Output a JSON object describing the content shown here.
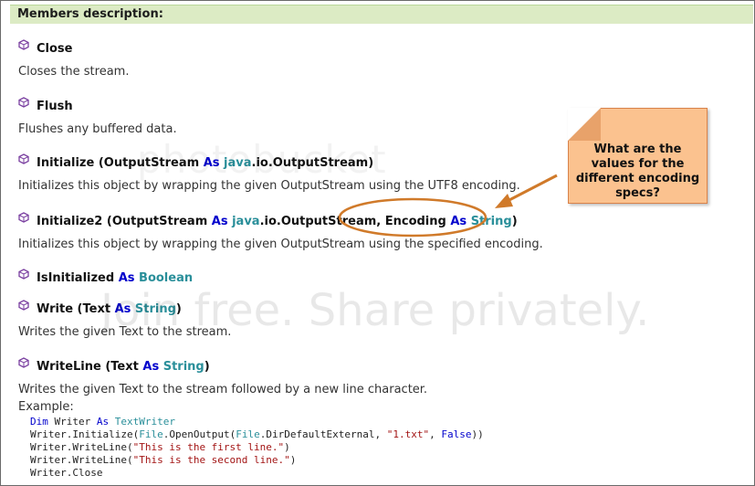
{
  "header": {
    "title": "Members description:"
  },
  "members": [
    {
      "name": "Close",
      "description": "Closes the stream."
    },
    {
      "name": "Flush",
      "description": "Flushes any buffered data."
    },
    {
      "name": "Initialize",
      "p1": "(OutputStream ",
      "as": "As ",
      "pkg": "java",
      "rest": ".io.OutputStream)",
      "description": "Initializes this object by wrapping the given OutputStream using the UTF8 encoding."
    },
    {
      "name": "Initialize2",
      "p1": "(OutputStream ",
      "as": "As ",
      "pkg": "java",
      "rest": ".io.OutputStream, Encoding ",
      "as2": "As ",
      "type2": "String",
      "close": ")",
      "description": "Initializes this object by wrapping the given OutputStream using the specified encoding."
    },
    {
      "name": "IsInitialized",
      "as": " As ",
      "type": "Boolean"
    },
    {
      "name": "Write",
      "p1": " (Text ",
      "as": "As ",
      "type": "String",
      "close": ")",
      "description": "Writes the given Text to the stream."
    },
    {
      "name": "WriteLine",
      "p1": " (Text ",
      "as": "As ",
      "type": "String",
      "close": ")",
      "description": "Writes the given Text to the stream followed by a new line character."
    }
  ],
  "example_label": "Example:",
  "code": {
    "l1_kw1": "Dim",
    "l1_mid": " Writer ",
    "l1_kw2": "As",
    "l1_type": " TextWriter",
    "l2_a": "Writer.Initialize(",
    "l2_type1": "File",
    "l2_b": ".OpenOutput(",
    "l2_type2": "File",
    "l2_c": ".DirDefaultExternal, ",
    "l2_str": "\"1.txt\"",
    "l2_d": ", ",
    "l2_kw": "False",
    "l2_e": "))",
    "l3_a": "Writer.WriteLine(",
    "l3_str": "\"This is the first line.\"",
    "l3_b": ")",
    "l4_a": "Writer.WriteLine(",
    "l4_str": "\"This is the second line.\"",
    "l4_b": ")",
    "l5": "Writer.Close"
  },
  "callout": {
    "text": "What are the values for the different encoding specs?"
  },
  "watermark": {
    "top": "photobucket",
    "bottom": "Join free. Share privately."
  },
  "colors": {
    "keyword": "#0000cc",
    "type": "#2a8f9a",
    "callout_fill": "#fbc28f",
    "callout_border": "#d8824a",
    "highlight_ellipse": "#d07a2a",
    "header_bg": "#dcebc4"
  }
}
